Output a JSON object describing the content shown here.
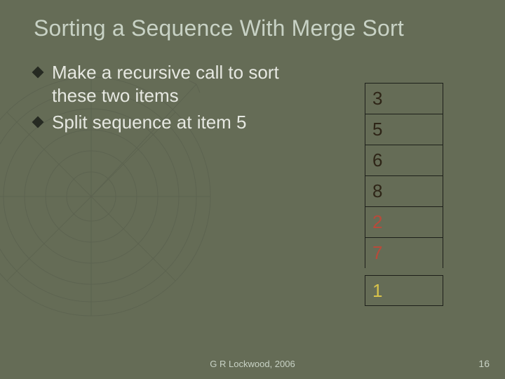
{
  "title": "Sorting a Sequence With Merge Sort",
  "bullets": [
    "Make a recursive call to sort these two items",
    "Split sequence at item 5"
  ],
  "cells": [
    {
      "value": "3",
      "cls": "cell-dark"
    },
    {
      "value": "5",
      "cls": "cell-dark"
    },
    {
      "value": "6",
      "cls": "cell-dark"
    },
    {
      "value": "8",
      "cls": "cell-dark"
    },
    {
      "value": "2",
      "cls": "cell-red"
    },
    {
      "value": "7",
      "cls": "cell-red"
    },
    {
      "value": "1",
      "cls": "cell-yel"
    }
  ],
  "gap_after_index": 5,
  "footer": "G R Lockwood, 2006",
  "page_number": "16"
}
